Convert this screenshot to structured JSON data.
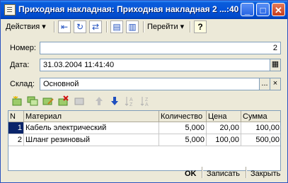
{
  "window": {
    "title": "Приходная накладная: Приходная накладная 2 ...:40",
    "minimize": "_",
    "maximize": "□",
    "close": "✕"
  },
  "toolbar": {
    "actions_label": "Действия",
    "goto_label": "Перейти",
    "help_label": "?",
    "dropdown_arrow": "▾"
  },
  "form": {
    "number_label": "Номер:",
    "number_value": "2",
    "date_label": "Дата:",
    "date_value": "31.03.2004 11:41:40",
    "warehouse_label": "Склад:",
    "warehouse_value": "Основной",
    "select_button": "...",
    "clear_button": "×"
  },
  "table": {
    "columns": [
      "N",
      "Материал",
      "Количество",
      "Цена",
      "Сумма"
    ],
    "rows": [
      {
        "n": "1",
        "material": "Кабель электрический",
        "qty": "5,000",
        "price": "20,00",
        "sum": "100,00"
      },
      {
        "n": "2",
        "material": "Шланг резиновый",
        "qty": "5,000",
        "price": "100,00",
        "sum": "500,00"
      }
    ]
  },
  "footer": {
    "ok_label": "OK",
    "save_label": "Записать",
    "close_label": "Закрыть"
  }
}
